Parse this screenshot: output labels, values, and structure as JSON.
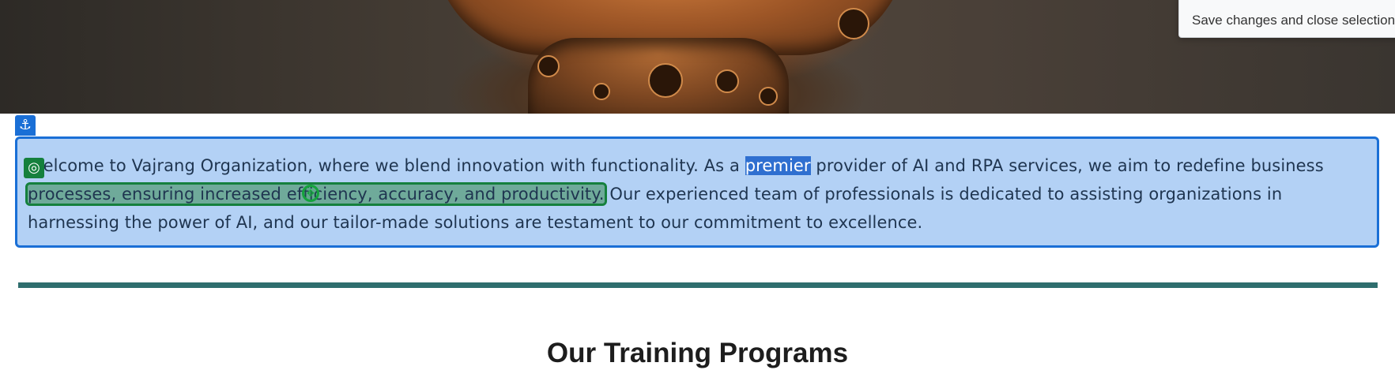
{
  "tooltip": {
    "text": "Save changes and close selection"
  },
  "paragraph": {
    "line1_before": "Welcome to Vajrang Organization, where we blend innovation with functionality. As a ",
    "line1_highlight": "premier",
    "line1_after": " provider of AI and RPA services, we aim to redefine business",
    "line2_selected": "processes, ensuring increased efficiency, accuracy, and productivity.",
    "line2_after": " Our experienced team of professionals is dedicated to assisting organizations in",
    "line3": "harnessing the power of AI, and our tailor-made solutions are testament to our commitment to excellence."
  },
  "section": {
    "title": "Our Training Programs"
  },
  "icons": {
    "anchor": "anchor-icon",
    "target": "target-icon",
    "move": "move-cursor-icon"
  },
  "colors": {
    "selection_blue": "#1a6fd6",
    "selection_fill": "#b3d1f5",
    "green_selection": "#15803d",
    "divider": "#2f6e6e"
  }
}
